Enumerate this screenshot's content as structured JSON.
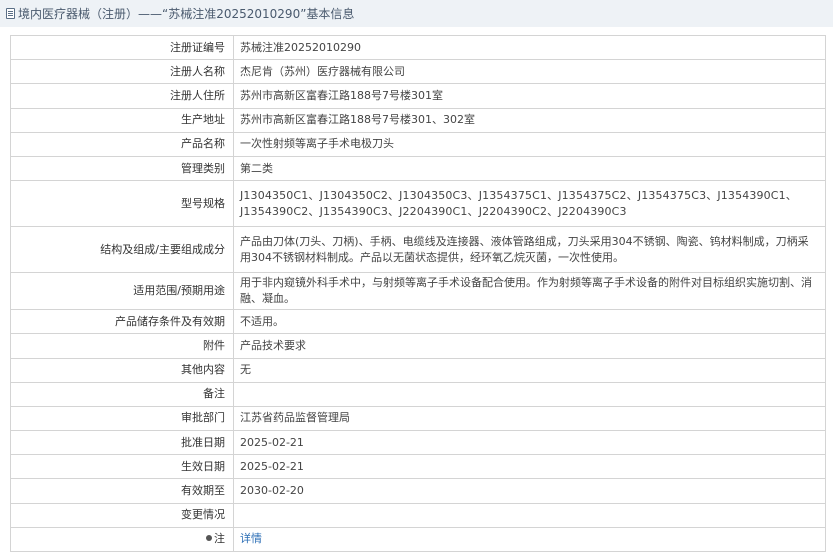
{
  "header": {
    "title": "境内医疗器械（注册）——“苏械注准20252010290”基本信息"
  },
  "rows": [
    {
      "label": "注册证编号",
      "value": "苏械注准20252010290"
    },
    {
      "label": "注册人名称",
      "value": "杰尼肯（苏州）医疗器械有限公司"
    },
    {
      "label": "注册人住所",
      "value": "苏州市高新区富春江路188号7号楼301室"
    },
    {
      "label": "生产地址",
      "value": "苏州市高新区富春江路188号7号楼301、302室"
    },
    {
      "label": "产品名称",
      "value": "一次性射频等离子手术电极刀头"
    },
    {
      "label": "管理类别",
      "value": "第二类"
    },
    {
      "label": "型号规格",
      "value": "J1304350C1、J1304350C2、J1304350C3、J1354375C1、J1354375C2、J1354375C3、J1354390C1、J1354390C2、J1354390C3、J2204390C1、J2204390C2、J2204390C3"
    },
    {
      "label": "结构及组成/主要组成成分",
      "value": "产品由刀体(刀头、刀柄)、手柄、电缆线及连接器、液体管路组成，刀头采用304不锈钢、陶瓷、钨材料制成，刀柄采用304不锈钢材料制成。产品以无菌状态提供，经环氧乙烷灭菌，一次性使用。"
    },
    {
      "label": "适用范围/预期用途",
      "value": "用于非内窥镜外科手术中，与射频等离子手术设备配合使用。作为射频等离子手术设备的附件对目标组织实施切割、消融、凝血。"
    },
    {
      "label": "产品储存条件及有效期",
      "value": "不适用。"
    },
    {
      "label": "附件",
      "value": "产品技术要求"
    },
    {
      "label": "其他内容",
      "value": "无"
    },
    {
      "label": "备注",
      "value": ""
    },
    {
      "label": "审批部门",
      "value": "江苏省药品监督管理局"
    },
    {
      "label": "批准日期",
      "value": "2025-02-21"
    },
    {
      "label": "生效日期",
      "value": "2025-02-21"
    },
    {
      "label": "有效期至",
      "value": "2030-02-20"
    },
    {
      "label": "变更情况",
      "value": ""
    }
  ],
  "note_row": {
    "label": "注",
    "link_text": "详情"
  }
}
